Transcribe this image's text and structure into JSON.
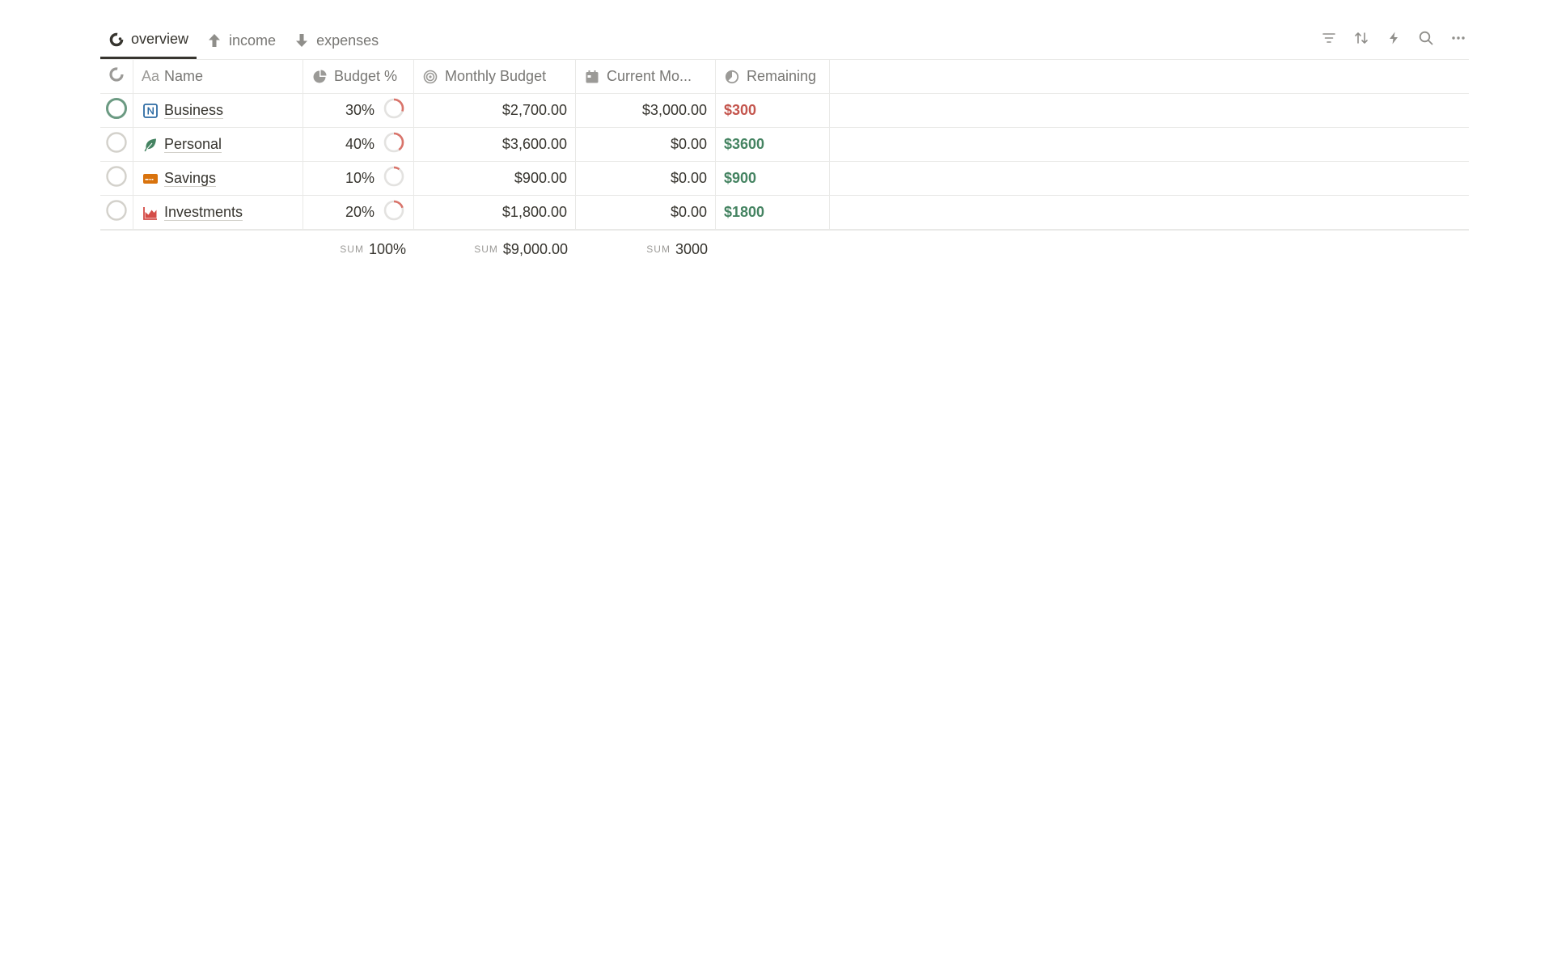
{
  "tabs": [
    {
      "label": "overview",
      "icon": "pie-chart-icon",
      "active": true
    },
    {
      "label": "income",
      "icon": "arrow-up-icon",
      "active": false
    },
    {
      "label": "expenses",
      "icon": "arrow-down-icon",
      "active": false
    }
  ],
  "toolbar": [
    "filter-icon",
    "sort-icon",
    "automation-bolt-icon",
    "search-icon",
    "more-icon"
  ],
  "columns": {
    "name": "Name",
    "name_prefix": "Aa",
    "budget_pct": "Budget %",
    "monthly_budget": "Monthly Budget",
    "current_month": "Current Mo...",
    "remaining": "Remaining"
  },
  "rows": [
    {
      "name": "Business",
      "icon": "notion-logo-icon",
      "budget_pct": "30%",
      "budget_frac": 0.3,
      "monthly_budget": "$2,700.00",
      "current_month": "$3,000.00",
      "remaining": "$300",
      "remaining_color": "#c4554d",
      "status_active": true
    },
    {
      "name": "Personal",
      "icon": "leaf-icon",
      "budget_pct": "40%",
      "budget_frac": 0.4,
      "monthly_budget": "$3,600.00",
      "current_month": "$0.00",
      "remaining": "$3600",
      "remaining_color": "#448361",
      "status_active": false
    },
    {
      "name": "Savings",
      "icon": "credit-card-icon",
      "budget_pct": "10%",
      "budget_frac": 0.1,
      "monthly_budget": "$900.00",
      "current_month": "$0.00",
      "remaining": "$900",
      "remaining_color": "#448361",
      "status_active": false
    },
    {
      "name": "Investments",
      "icon": "area-chart-icon",
      "budget_pct": "20%",
      "budget_frac": 0.2,
      "monthly_budget": "$1,800.00",
      "current_month": "$0.00",
      "remaining": "$1800",
      "remaining_color": "#448361",
      "status_active": false
    }
  ],
  "footer": {
    "sum_label": "SUM",
    "budget_pct_sum": "100%",
    "monthly_budget_sum": "$9,000.00",
    "current_month_sum": "3000"
  },
  "colors": {
    "ring_progress": "#d9736a",
    "ring_track": "#e3e2e0",
    "status_active": "#6b9a82",
    "status_inactive": "#d3d1cb",
    "notion_blue": "#2e6ca4",
    "leaf_green": "#448361",
    "card_orange": "#d9730d",
    "chart_red": "#d44c47"
  }
}
